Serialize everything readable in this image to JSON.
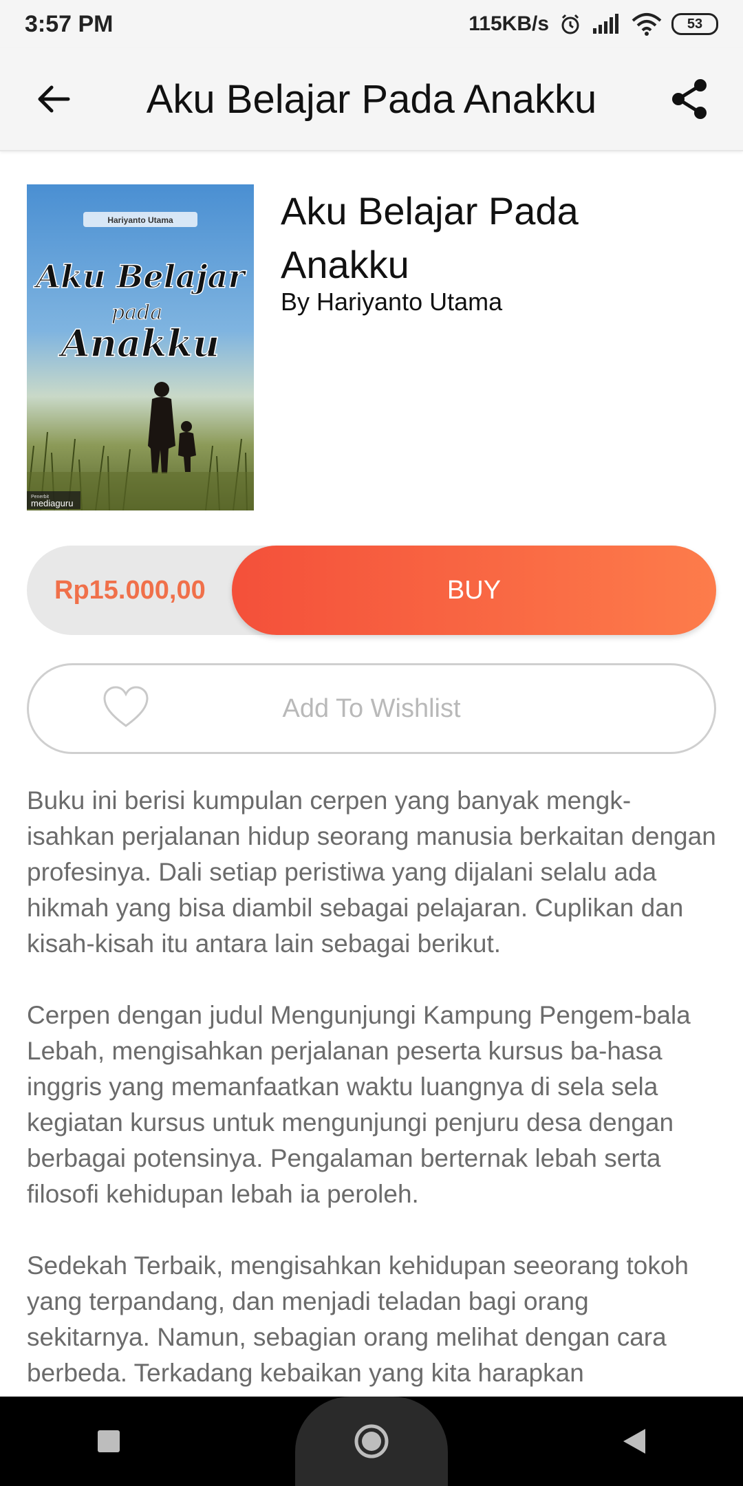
{
  "status_bar": {
    "time": "3:57 PM",
    "network_speed": "115KB/s",
    "battery": "53"
  },
  "app_bar": {
    "title": "Aku Belajar Pada Anakku"
  },
  "book": {
    "cover": {
      "author": "Hariyanto Utama",
      "title_script": "Aku Belajar",
      "title_small": "pada",
      "title_big": "Anakku",
      "publisher_small": "Penerbit",
      "publisher": "mediaguru"
    },
    "title": "Aku Belajar Pada Anakku",
    "author": "By Hariyanto Utama"
  },
  "purchase": {
    "price": "Rp15.000,00",
    "buy_label": "BUY"
  },
  "wishlist": {
    "label": "Add To Wishlist"
  },
  "description": {
    "paragraphs": [
      "Buku ini berisi kumpulan cerpen yang banyak mengk-isahkan perjalanan hidup seorang manusia berkaitan dengan profesinya. Dali setiap peristiwa yang dijalani selalu ada hikmah yang bisa diambil sebagai pelajaran. Cuplikan dan kisah-kisah itu antara lain sebagai berikut.",
      "Cerpen dengan judul Mengunjungi Kampung Pengem-bala Lebah, mengisahkan perjalanan peserta kursus ba-hasa inggris yang memanfaatkan waktu luangnya di sela sela kegiatan kursus untuk mengunjungi penjuru desa dengan berbagai potensinya. Pengalaman berternak lebah serta filosofi kehidupan lebah ia peroleh.",
      "Sedekah Terbaik, mengisahkan kehidupan seeorang tokoh yang terpandang, dan menjadi teladan bagi orang sekitarnya. Namun, sebagian orang melihat dengan cara berbeda. Terkadang kebaikan yang kita harapkan"
    ]
  },
  "colors": {
    "accent_start": "#f4503a",
    "accent_end": "#fd7c4b",
    "price": "#f0704a"
  }
}
